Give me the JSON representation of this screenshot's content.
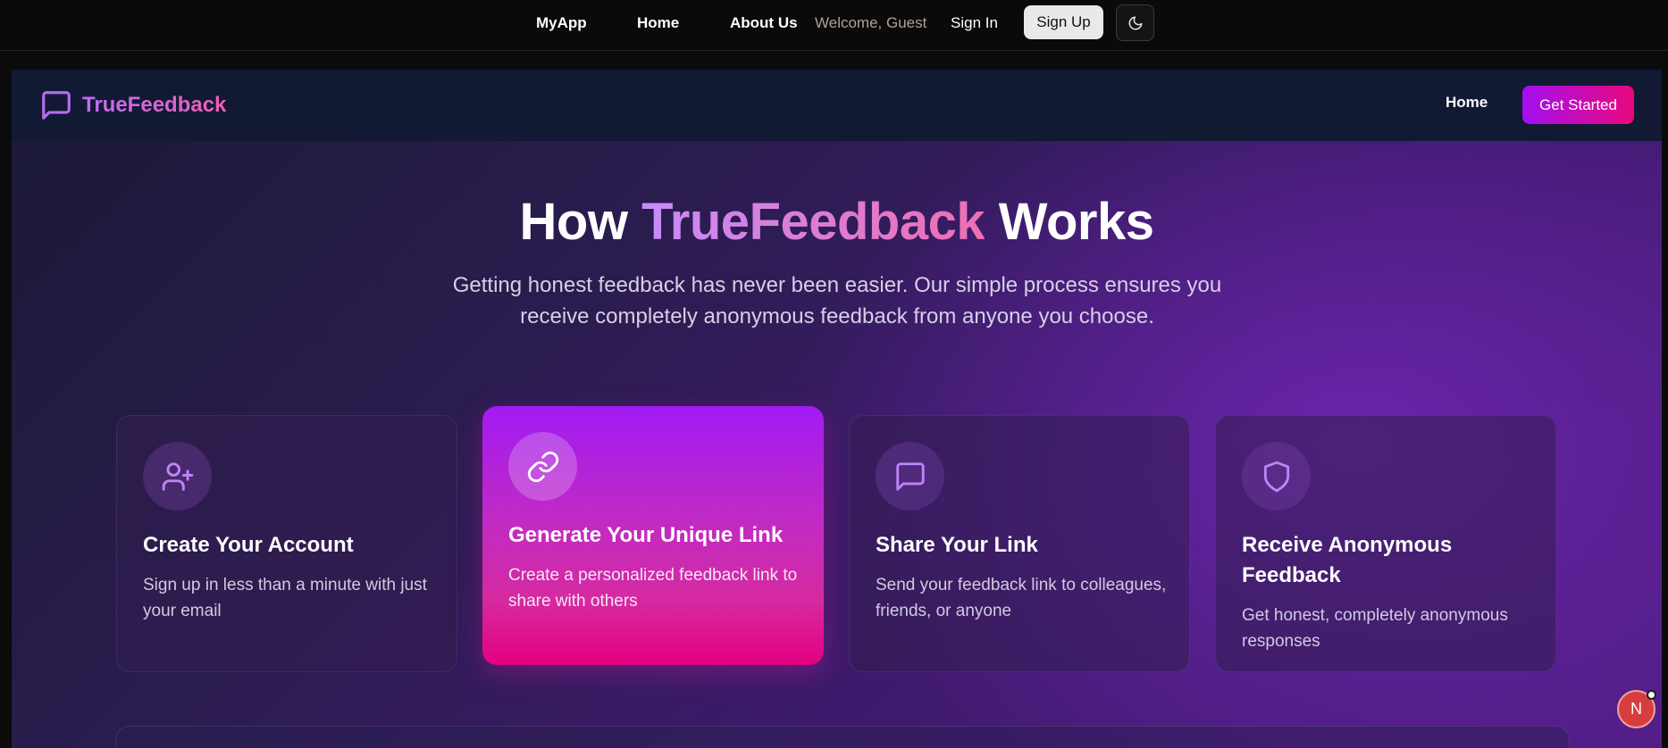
{
  "topnav": {
    "brand": "MyApp",
    "home": "Home",
    "about": "About Us",
    "welcome": "Welcome, Guest",
    "sign_in": "Sign In",
    "sign_up": "Sign Up",
    "theme_icon": "moon-icon"
  },
  "app_header": {
    "brand": "TrueFeedback",
    "brand_icon": "message-square-icon",
    "nav_home": "Home",
    "cta": "Get Started"
  },
  "hero": {
    "title_before": "How ",
    "title_accent": "TrueFeedback",
    "title_after": " Works",
    "subtitle": "Getting honest feedback has never been easier. Our simple process ensures you receive completely anonymous feedback from anyone you choose."
  },
  "steps": [
    {
      "icon": "user-plus-icon",
      "title": "Create Your Account",
      "description": "Sign up in less than a minute with just your email"
    },
    {
      "icon": "link-icon",
      "title": "Generate Your Unique Link",
      "description": "Create a personalized feedback link to share with others"
    },
    {
      "icon": "message-square-icon",
      "title": "Share Your Link",
      "description": "Send your feedback link to colleagues, friends, or anyone"
    },
    {
      "icon": "shield-icon",
      "title": "Receive Anonymous Feedback",
      "description": "Get honest, completely anonymous responses"
    }
  ],
  "avatar": {
    "initial": "N"
  },
  "colors": {
    "accent_purple": "#a30ff0",
    "accent_pink": "#e9087c",
    "icon_purple": "#c084fc"
  }
}
